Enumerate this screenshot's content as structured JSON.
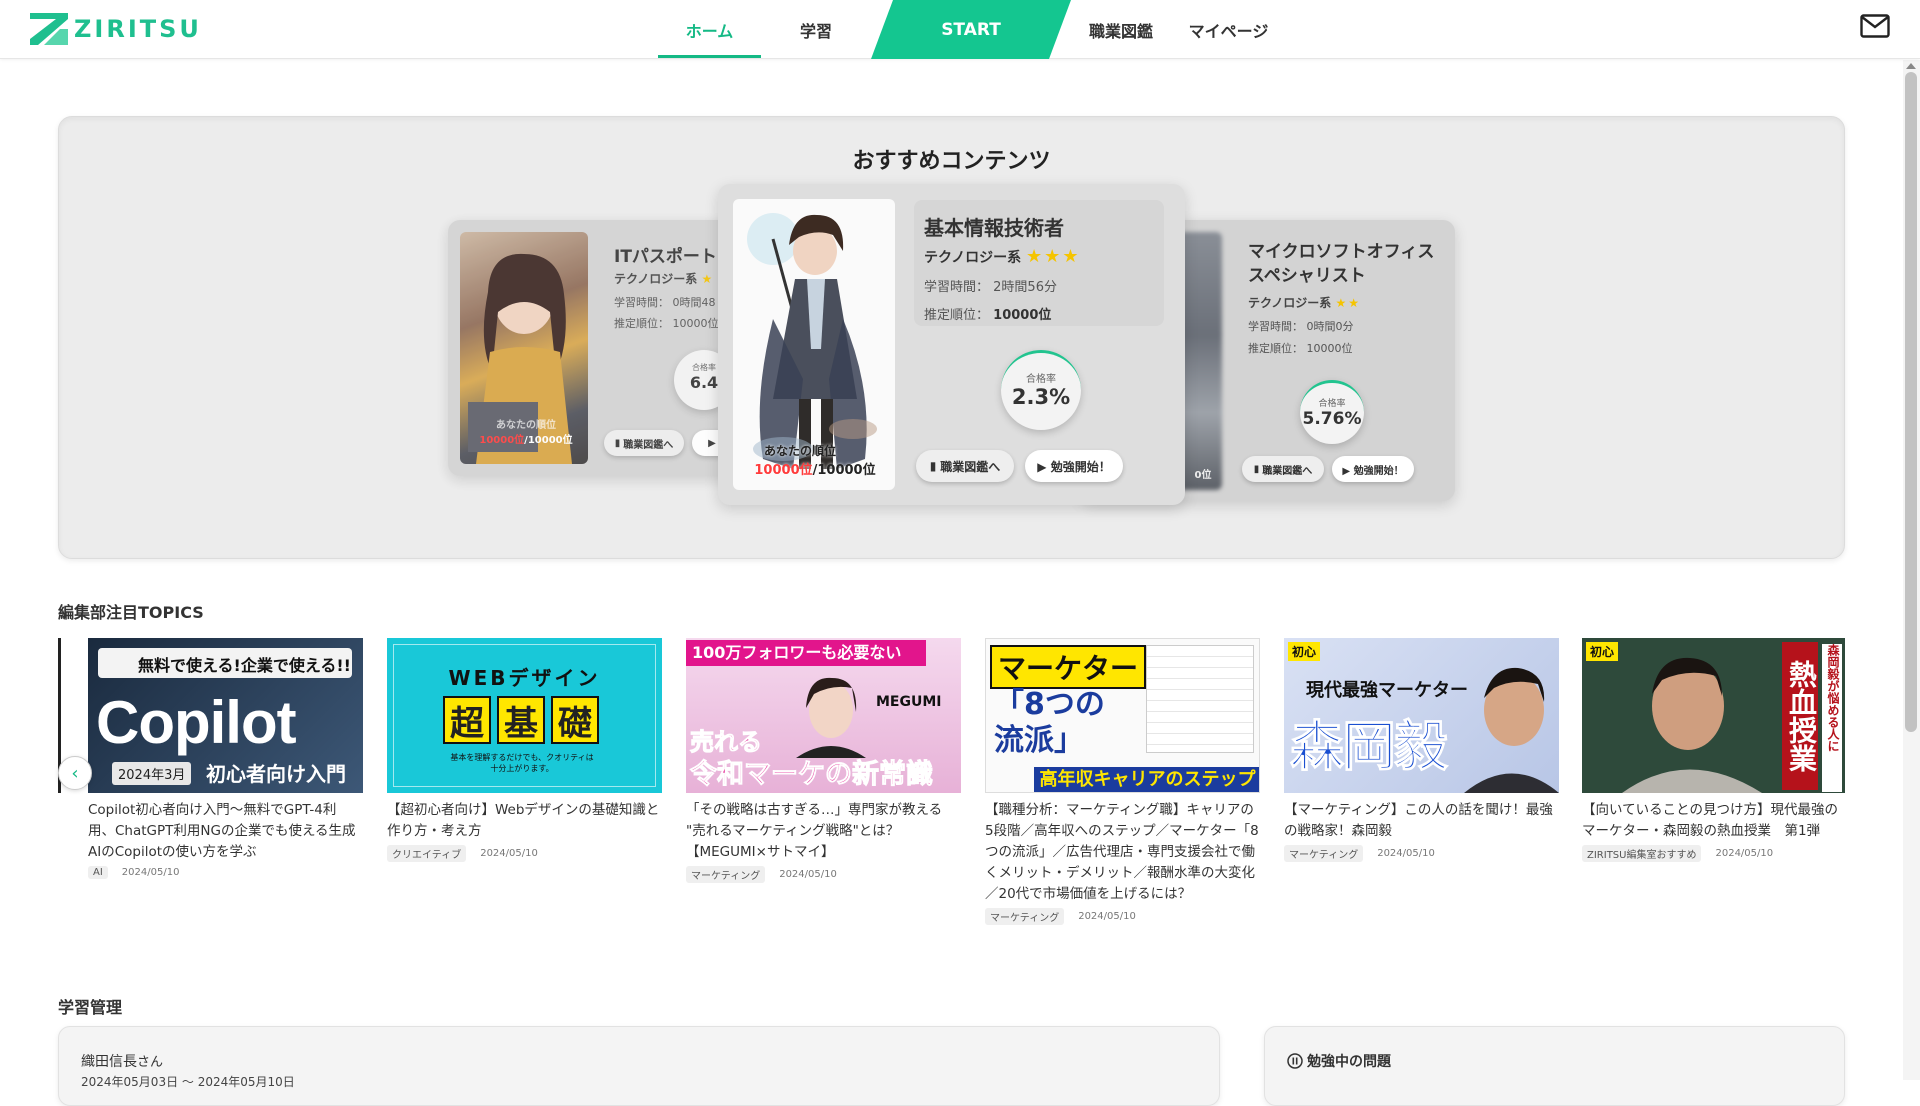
{
  "header": {
    "logo_text": "ZIRITSU",
    "nav": {
      "home": "ホーム",
      "study": "学習",
      "start": "START",
      "jobs": "職業図鑑",
      "mypage": "マイページ"
    },
    "accent": "#14b985"
  },
  "recommend": {
    "title": "おすすめコンテンツ",
    "cards": [
      {
        "title": "ITパスポート",
        "category": "テクノロジー系",
        "stars": "★",
        "study_time_label": "学習時間：",
        "study_time": "0時間48",
        "rank_label": "推定順位：",
        "rank": "10000位",
        "pass_label": "合格率",
        "pass_rate": "6.4",
        "your_rank_label": "あなたの順位",
        "your_rank": "10000位",
        "your_rank_total": "/10000位",
        "jobs_button": "職業図鑑へ",
        "start_button": "▶"
      },
      {
        "title": "基本情報技術者",
        "category": "テクノロジー系",
        "stars": "★★★",
        "study_time_label": "学習時間：",
        "study_time": "2時間56分",
        "rank_label": "推定順位：",
        "rank": "10000位",
        "pass_label": "合格率",
        "pass_rate": "2.3%",
        "your_rank_label": "あなたの順位",
        "your_rank": "10000位",
        "your_rank_total": "/10000位",
        "jobs_button": "職業図鑑へ",
        "start_button": "▶ 勉強開始！"
      },
      {
        "title_line1": "マイクロソフトオフィス",
        "title_line2": "スペシャリスト",
        "category": "テクノロジー系",
        "stars": "★★",
        "study_time_label": "学習時間：",
        "study_time": "0時間0分",
        "rank_label": "推定順位：",
        "rank": "10000位",
        "pass_label": "合格率",
        "pass_rate": "5.76%",
        "your_rank_total": "0位",
        "jobs_button": "職業図鑑へ",
        "start_button": "▶ 勉強開始！"
      }
    ]
  },
  "topics": {
    "label": "編集部注目TOPICS",
    "items": [
      {
        "thumb_top": "無料で使える!企業で使える!!",
        "thumb_big": "Copilot",
        "thumb_badge": "2024年3月",
        "thumb_sub": "初心者向け入門",
        "title": "Copilot初心者向け入門〜無料でGPT-4利用、ChatGPT利用NGの企業でも使える生成AIのCopilotの使い方を学ぶ",
        "tag": "AI",
        "date": "2024/05/10"
      },
      {
        "thumb_top": "WEBデザイン",
        "thumb_big": [
          "超",
          "基",
          "礎"
        ],
        "thumb_sub": "基本を理解するだけでも、クオリティは十分上がります。",
        "title": "【超初心者向け】Webデザインの基礎知識と作り方・考え方",
        "tag": "クリエイティブ",
        "date": "2024/05/10"
      },
      {
        "thumb_top": "100万フォロワーも必要ない",
        "thumb_name": "MEGUMI",
        "thumb_big1": "売れる",
        "thumb_big2": "令和マーケの新常識",
        "title": "「その戦略は古すぎる…」専門家が教える \"売れるマーケティング戦略\"とは？【MEGUMI×サトマイ】",
        "tag": "マーケティング",
        "date": "2024/05/10"
      },
      {
        "thumb_top": "マーケター",
        "thumb_big": "「8つの流派」",
        "thumb_sub": "高年収キャリアのステップ",
        "title": "【職種分析：マーケティング職】キャリアの5段階／高年収へのステップ／マーケター「8つの流派」／広告代理店・専門支援会社で働くメリット・デメリット／報酬水準の大変化／20代で市場価値を上げるには？",
        "tag": "マーケティング",
        "date": "2024/05/10"
      },
      {
        "thumb_top": "現代最強マーケター",
        "thumb_big": "森岡毅",
        "thumb_badge": "初心",
        "title": "【マーケティング】この人の話を聞け！最強の戦略家！森岡毅",
        "tag": "マーケティング",
        "date": "2024/05/10"
      },
      {
        "thumb_big": "熱血授業",
        "thumb_side": "森岡毅が悩める人に",
        "thumb_badge": "初心",
        "title": "【向いていることの見つけ方】現代最強のマーケター・森岡毅の熱血授業　第1弾",
        "tag": "ZIRITSU編集室おすすめ",
        "date": "2024/05/10"
      }
    ]
  },
  "study": {
    "label": "学習管理",
    "user_name": "織田信長",
    "user_suffix": "さん",
    "date_range": "2024年05月03日 〜 2024年05月10日",
    "studying_title": "勉強中の問題"
  }
}
